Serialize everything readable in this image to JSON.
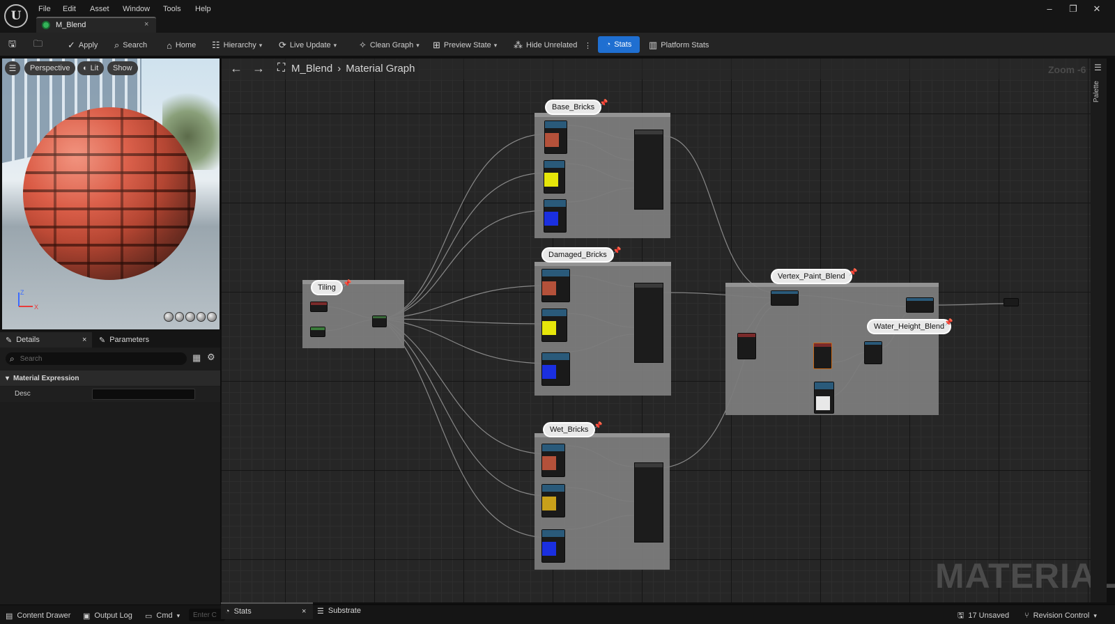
{
  "menu": [
    "File",
    "Edit",
    "Asset",
    "Window",
    "Tools",
    "Help"
  ],
  "tab": {
    "label": "M_Blend",
    "close": "×"
  },
  "window_controls": {
    "minimize": "–",
    "restore": "❐",
    "close": "✕"
  },
  "toolbar": {
    "apply": "Apply",
    "search": "Search",
    "home": "Home",
    "hierarchy": "Hierarchy",
    "live_update": "Live Update",
    "clean_graph": "Clean Graph",
    "preview_state": "Preview State",
    "hide_unrelated": "Hide Unrelated",
    "stats": "Stats",
    "platform_stats": "Platform Stats"
  },
  "viewport": {
    "perspective": "Perspective",
    "lit": "Lit",
    "show": "Show",
    "axis_z": "Z",
    "axis_x": "X"
  },
  "details": {
    "tab_details": "Details",
    "tab_parameters": "Parameters",
    "close": "×",
    "search_placeholder": "Search",
    "category": "Material Expression",
    "desc_label": "Desc",
    "desc_value": ""
  },
  "graph": {
    "asset": "M_Blend",
    "section": "Material Graph",
    "zoom": "Zoom -6",
    "watermark": "MATERIAL",
    "palette": "Palette",
    "comments": {
      "base": "Base_Bricks",
      "damaged": "Damaged_Bricks",
      "wet": "Wet_Bricks",
      "tiling": "Tiling",
      "vertex": "Vertex_Paint_Blend",
      "water": "Water_Height_Blend"
    },
    "swatch_colors": {
      "brick": "#b4513a",
      "yellow": "#e6e60a",
      "blue": "#1a2fe0",
      "wet_yellow": "#c8a01a",
      "white": "#e8e8e8"
    }
  },
  "bottom": {
    "content_drawer": "Content Drawer",
    "output_log": "Output Log",
    "cmd": "Cmd",
    "cmd_placeholder": "Enter C",
    "stats_tab": "Stats",
    "substrate_tab": "Substrate",
    "unsaved": "17 Unsaved",
    "revision_control": "Revision Control"
  }
}
